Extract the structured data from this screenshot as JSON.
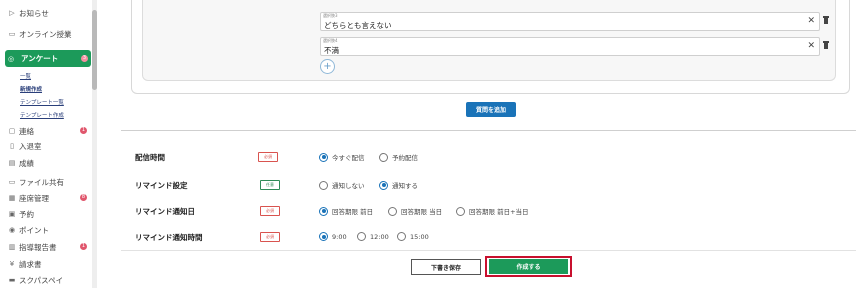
{
  "sidebar": {
    "items": [
      {
        "label": "お知らせ",
        "icon": "triangle-right-icon"
      },
      {
        "label": "オンライン授業",
        "icon": "monitor-icon"
      },
      {
        "label": "アンケート",
        "icon": "survey-icon",
        "badge": "3",
        "active": true
      },
      {
        "label": "連絡",
        "icon": "chat-icon",
        "badge": "1"
      },
      {
        "label": "入退室",
        "icon": "door-icon"
      },
      {
        "label": "成績",
        "icon": "report-icon"
      },
      {
        "label": "ファイル共有",
        "icon": "folder-icon"
      },
      {
        "label": "座席管理",
        "icon": "seat-icon",
        "badge": "8"
      },
      {
        "label": "予約",
        "icon": "calendar-icon"
      },
      {
        "label": "ポイント",
        "icon": "point-icon"
      },
      {
        "label": "指導報告書",
        "icon": "book-icon",
        "badge": "1"
      },
      {
        "label": "請求書",
        "icon": "yen-icon"
      },
      {
        "label": "スクパスペイ",
        "icon": "card-icon"
      }
    ],
    "subitems": [
      "一覧",
      "新規作成",
      "テンプレート一覧",
      "テンプレート作成"
    ]
  },
  "choices": [
    {
      "label": "選択肢3",
      "value": "どちらとも言えない"
    },
    {
      "label": "選択肢4",
      "value": "不満"
    }
  ],
  "buttons": {
    "add_question": "質問を追加",
    "save_draft": "下書き保存",
    "create": "作成する",
    "add_choice": "+"
  },
  "settings": [
    {
      "label": "配信時間",
      "tag": "必須",
      "options": [
        "今すぐ配信",
        "予約配信"
      ],
      "selected": 0
    },
    {
      "label": "リマインド設定",
      "tag": "任意",
      "options": [
        "通知しない",
        "通知する"
      ],
      "selected": 1
    },
    {
      "label": "リマインド通知日",
      "tag": "必須",
      "options": [
        "回答期限 前日",
        "回答期限 当日",
        "回答期限 前日+当日"
      ],
      "selected": 0
    },
    {
      "label": "リマインド通知時間",
      "tag": "必須",
      "options": [
        "9:00",
        "12:00",
        "15:00"
      ],
      "selected": 0
    }
  ],
  "colors": {
    "primary_green": "#1c9a5a",
    "primary_blue": "#1a73b8",
    "highlight_red": "#c8102e"
  }
}
